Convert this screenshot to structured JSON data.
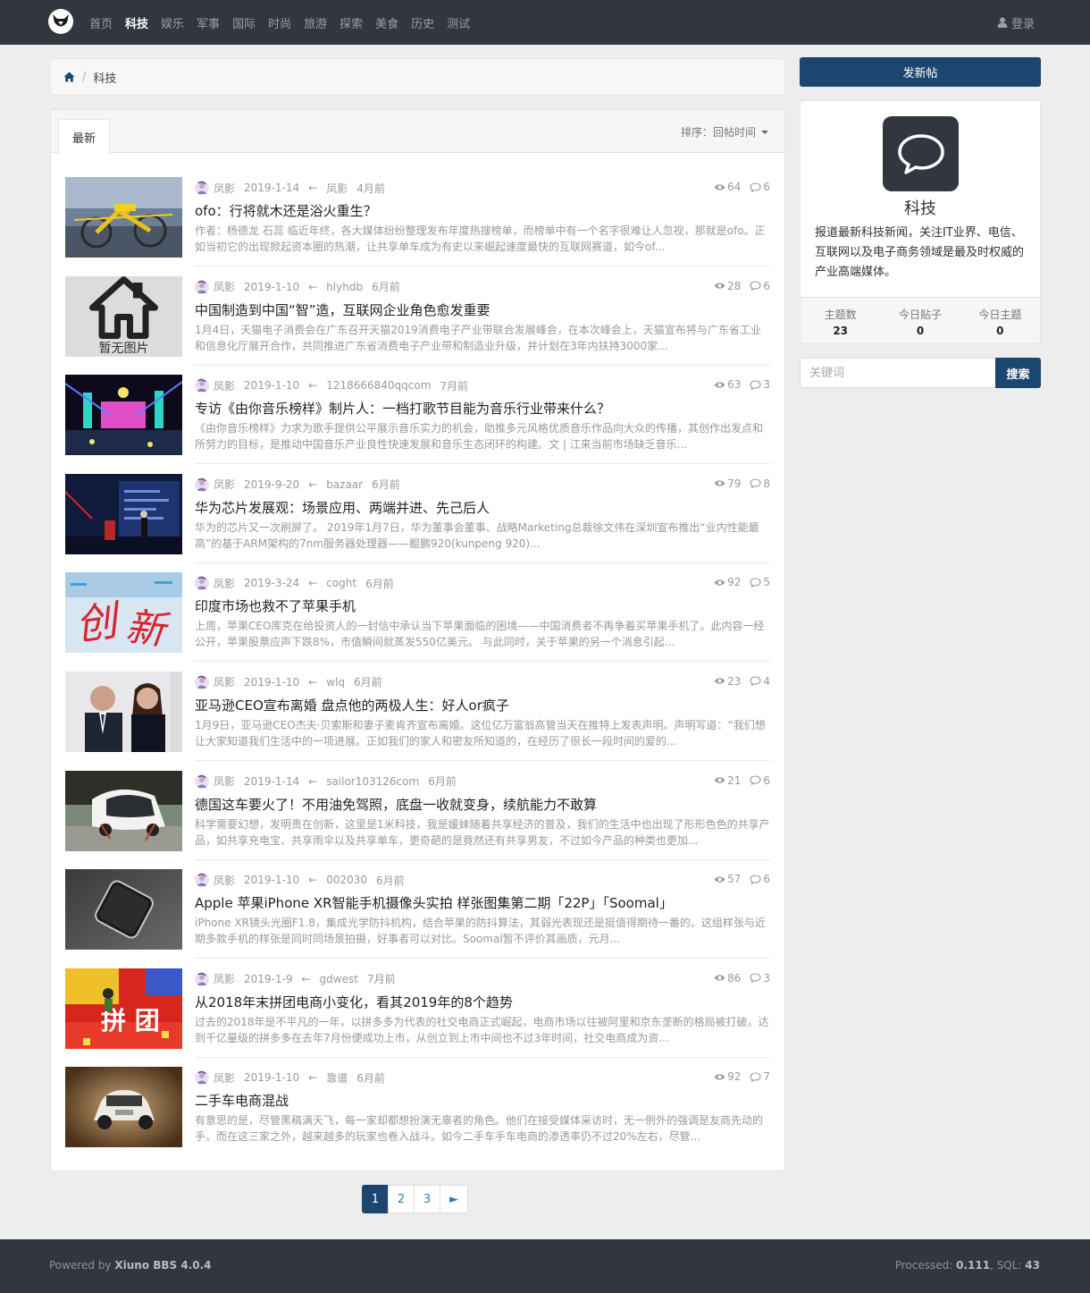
{
  "nav": {
    "items": [
      "首页",
      "科技",
      "娱乐",
      "军事",
      "国际",
      "时尚",
      "旅游",
      "探索",
      "美食",
      "历史",
      "测试"
    ],
    "active_index": 1,
    "login_label": "登录"
  },
  "breadcrumb": {
    "current": "科技"
  },
  "list": {
    "tab_label": "最新",
    "sort_label": "排序：回帖时间",
    "no_image_label": "暂无图片"
  },
  "threads": [
    {
      "author": "凤影",
      "date": "2019-1-14",
      "last_user": "凤影",
      "last_time": "4月前",
      "views": "64",
      "replies": "6",
      "title": "ofo：行将就木还是浴火重生？",
      "summary": "作者：杨德龙 石蕊 临近年终，各大媒体纷纷整理发布年度热搜榜单，而榜单中有一个名字很难让人忽视，那就是ofo。正如当初它的出现掀起资本圈的热潮，让共享单车成为有史以来崛起速度最快的互联网赛道，如今of..."
    },
    {
      "author": "凤影",
      "date": "2019-1-10",
      "last_user": "hlyhdb",
      "last_time": "6月前",
      "views": "28",
      "replies": "6",
      "title": "中国制造到中国“智”造，互联网企业角色愈发重要",
      "summary": "1月4日，天猫电子消费会在广东召开天猫2019消费电子产业带联合发展峰会，在本次峰会上，天猫宣布将与广东省工业和信息化厅展开合作，共同推进广东省消费电子产业带和制造业升级，并计划在3年内扶持3000家..."
    },
    {
      "author": "凤影",
      "date": "2019-1-10",
      "last_user": "1218666840qqcom",
      "last_time": "7月前",
      "views": "63",
      "replies": "3",
      "title": "专访《由你音乐榜样》制片人：一档打歌节目能为音乐行业带来什么？",
      "summary": "《由你音乐榜样》力求为歌手提供公平展示音乐实力的机会，助推多元风格优质音乐作品向大众的传播，其创作出发点和所努力的目标，是推动中国音乐产业良性快速发展和音乐生态闭环的构建。文 | 江来当前市场缺乏音乐..."
    },
    {
      "author": "凤影",
      "date": "2019-9-20",
      "last_user": "bazaar",
      "last_time": "6月前",
      "views": "79",
      "replies": "8",
      "title": "华为芯片发展观：场景应用、两端并进、先己后人",
      "summary": "华为的芯片又一次刷屏了。 2019年1月7日，华为董事会董事、战略Marketing总裁徐文伟在深圳宣布推出“业内性能最高”的基于ARM架构的7nm服务器处理器——鲲鹏920(kunpeng 920)..."
    },
    {
      "author": "凤影",
      "date": "2019-3-24",
      "last_user": "coght",
      "last_time": "6月前",
      "views": "92",
      "replies": "5",
      "title": "印度市场也救不了苹果手机",
      "summary": "上周，苹果CEO库克在给投资人的一封信中承认当下苹果面临的困境——中国消费者不再争着买苹果手机了。此内容一经公开，苹果股票应声下跌8%，市值瞬间就蒸发550亿美元。 与此同时，关于苹果的另一个消息引起..."
    },
    {
      "author": "凤影",
      "date": "2019-1-10",
      "last_user": "wlq",
      "last_time": "6月前",
      "views": "23",
      "replies": "4",
      "title": "亚马逊CEO宣布离婚 盘点他的两极人生：好人or疯子",
      "summary": "1月9日，亚马逊CEO杰夫·贝索斯和妻子麦肯齐宣布离婚。这位亿万富翁高管当天在推特上发表声明。声明写道：“我们想让大家知道我们生活中的一项进展。正如我们的家人和密友所知道的，在经历了很长一段时间的爱的..."
    },
    {
      "author": "凤影",
      "date": "2019-1-14",
      "last_user": "sailor103126com",
      "last_time": "6月前",
      "views": "21",
      "replies": "6",
      "title": "德国这车要火了！不用油免驾照，底盘一收就变身，续航能力不敢算",
      "summary": "科学需要幻想，发明贵在创新，这里是1米科技，我是媛妹随着共享经济的普及，我们的生活中也出现了形形色色的共享产品，如共享充电宝、共享雨伞以及共享单车，更奇葩的是竟然还有共享男友，不过如今产品的种类也更加..."
    },
    {
      "author": "凤影",
      "date": "2019-1-10",
      "last_user": "002030",
      "last_time": "6月前",
      "views": "57",
      "replies": "6",
      "title": "Apple 苹果iPhone XR智能手机摄像头实拍 样张图集第二期「22P」「Soomal」",
      "summary": "iPhone XR镜头光圈F1.8，集成光学防抖机构，结合苹果的防抖算法，其弱光表现还是挺值得期待一番的。这组样张与近期多款手机的样张是同时同场景拍摄，好事者可以对比。Soomal暂不评价其画质，元月..."
    },
    {
      "author": "凤影",
      "date": "2019-1-9",
      "last_user": "gdwest",
      "last_time": "7月前",
      "views": "86",
      "replies": "3",
      "title": "从2018年末拼团电商小变化，看其2019年的8个趋势",
      "summary": "过去的2018年是不平凡的一年，以拼多多为代表的社交电商正式崛起，电商市场以往被阿里和京东垄断的格局被打破。达到千亿量级的拼多多在去年7月份便成功上市，从创立到上市中间也不过3年时间，社交电商成为资..."
    },
    {
      "author": "凤影",
      "date": "2019-1-10",
      "last_user": "靠谱",
      "last_time": "6月前",
      "views": "92",
      "replies": "7",
      "title": "二手车电商混战",
      "summary": "有意思的是，尽管黑稿满天飞，每一家却都想扮演无辜者的角色。他们在接受媒体采访时，无一例外的强调是友商先动的手。而在这三家之外，越来越多的玩家也卷入战斗。如今二手车手车电商的渗透率仍不过20%左右，尽管..."
    }
  ],
  "pagination": {
    "pages": [
      "1",
      "2",
      "3"
    ],
    "next": "►",
    "active": "1"
  },
  "sidebar": {
    "new_post_label": "发新帖",
    "forum_name": "科技",
    "forum_desc": "报道最新科技新闻，关注IT业界、电信、互联网以及电子商务领域是最及时权威的产业高端媒体。",
    "stats": [
      {
        "label": "主题数",
        "value": "23"
      },
      {
        "label": "今日贴子",
        "value": "0"
      },
      {
        "label": "今日主题",
        "value": "0"
      }
    ],
    "search_placeholder": "关键词",
    "search_label": "搜索"
  },
  "footer": {
    "powered_prefix": "Powered by ",
    "powered_name": "Xiuno BBS 4.0.4",
    "processed_prefix": "Processed: ",
    "processed_value": "0.111",
    "sql_prefix": ", SQL: ",
    "sql_value": "43"
  },
  "colors": {
    "topbar": "#32363e",
    "primary": "#1c4670",
    "page_bg": "#ededed"
  }
}
